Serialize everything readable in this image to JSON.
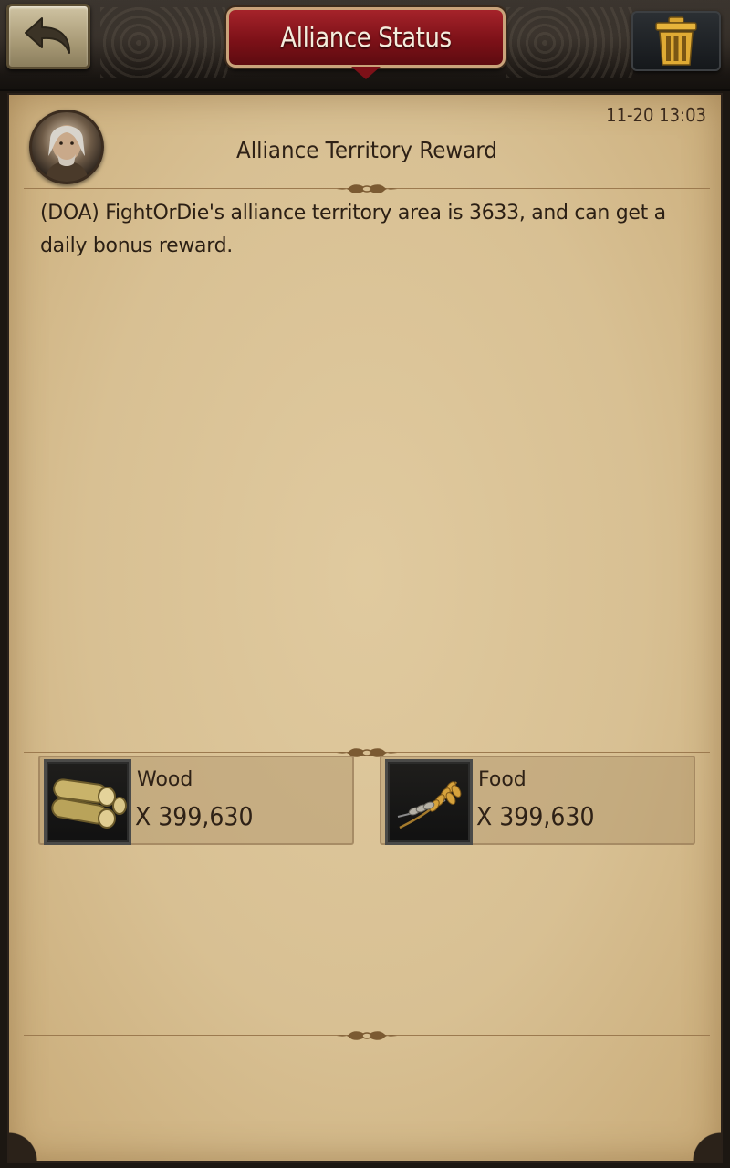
{
  "header": {
    "title": "Alliance Status",
    "back_icon": "back-arrow-icon",
    "trash_icon": "trash-icon"
  },
  "mail": {
    "timestamp": "11-20 13:03",
    "title": "Alliance Territory Reward",
    "body": " (DOA) FightOrDie's alliance territory area is 3633, and can get a daily bonus reward."
  },
  "rewards": [
    {
      "name": "Wood",
      "amount": "X 399,630",
      "icon": "wood-logs-icon"
    },
    {
      "name": "Food",
      "amount": "X 399,630",
      "icon": "wheat-icon"
    }
  ],
  "colors": {
    "title_plate": "#7d1118",
    "parchment": "#d8c093",
    "text": "#2e2116"
  }
}
